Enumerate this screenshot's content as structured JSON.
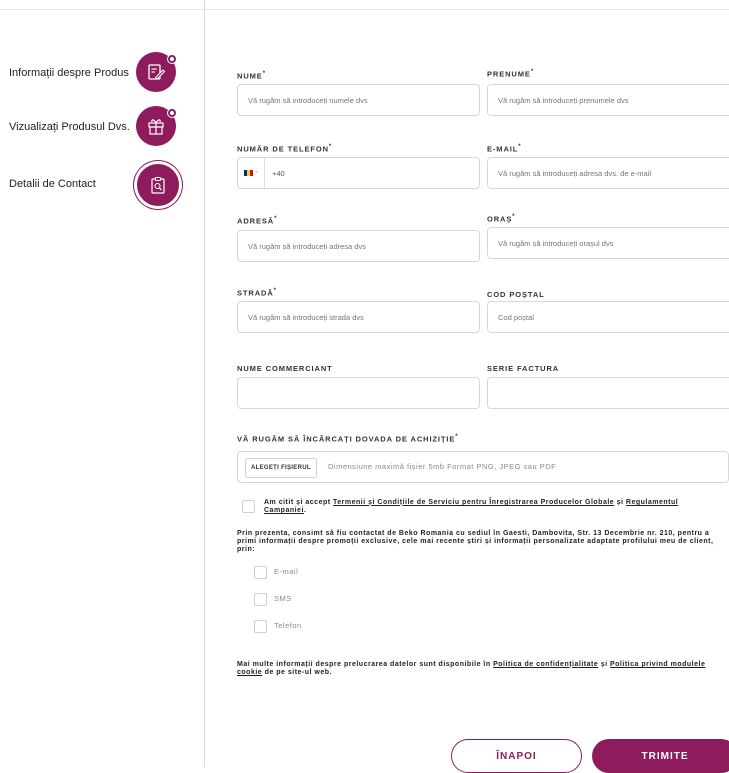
{
  "sidebar": {
    "steps": [
      {
        "label": "Informații despre Produs",
        "icon": "edit-document-icon"
      },
      {
        "label": "Vizualizați Produsul Dvs.",
        "icon": "gift-icon"
      },
      {
        "label": "Detalii de Contact",
        "icon": "clipboard-search-icon"
      }
    ]
  },
  "form": {
    "nume": {
      "label": "NUME",
      "required": "*",
      "placeholder": "Vă rugăm să introduceți numele dvs"
    },
    "prenume": {
      "label": "PRENUME",
      "required": "*",
      "placeholder": "Vă rugăm să introduceți prenumele dvs"
    },
    "telefon": {
      "label": "NUMĂR DE TELEFON",
      "required": "*",
      "value": "+40",
      "country_code_separator": "-"
    },
    "email": {
      "label": "E-MAIL",
      "required": "*",
      "placeholder": "Vă rugăm să introduceți adresa dvs. de e-mail"
    },
    "adresa": {
      "label": "ADRESĂ",
      "required": "*",
      "placeholder": "Vă rugăm să introduceți adresa dvs"
    },
    "oras": {
      "label": "ORAȘ",
      "required": "*",
      "placeholder": "Vă rugăm să introduceți orașul dvs"
    },
    "strada": {
      "label": "STRADĂ",
      "required": "*",
      "placeholder": "Vă rugăm să introduceți strada dvs"
    },
    "cod_postal": {
      "label": "COD POȘTAL",
      "placeholder": "Cod poștal"
    },
    "nume_comerciant": {
      "label": "NUME COMMERCIANT",
      "placeholder": ""
    },
    "serie_factura": {
      "label": "SERIE FACTURA",
      "placeholder": ""
    },
    "upload": {
      "label": "VĂ RUGĂM SĂ ÎNCĂRCAȚI DOVADA DE ACHIZIȚIE",
      "required": "*",
      "button": "ALEGEȚI FIȘIERUL",
      "hint": "Dimensiune maximă fișier 5mb Format PNG, JPEG sau PDF"
    },
    "terms": {
      "prefix": "Am citit și accept ",
      "link1": "Termenii și Condițiile de Serviciu pentru Înregistrarea Producelor Globale",
      "mid": " și ",
      "link2": "Regulamentul Campaniei",
      "suffix": "."
    },
    "consent_text": "Prin prezenta, consimt să fiu contactat de Beko Romania cu sediul în Gaesti, Dambovita, Str. 13 Decembrie nr. 210, pentru a primi informații despre promoții exclusive, cele mai recente știri și informații personalizate adaptate profilului meu de client, prin:",
    "channels": [
      "E-mail",
      "SMS",
      "Telefon"
    ],
    "privacy": {
      "prefix": "Mai multe informații despre prelucrarea datelor sunt disponibile în ",
      "link1": "Politica de confidențialitate",
      "mid": " și ",
      "link2": "Politica privind modulele cookie",
      "suffix": " de pe site-ul web."
    },
    "back_label": "ÎNAPOI",
    "submit_label": "TRIMITE"
  },
  "colors": {
    "accent": "#8e1b5c",
    "flag": [
      "#002b7f",
      "#fcd116",
      "#ce1126"
    ]
  }
}
